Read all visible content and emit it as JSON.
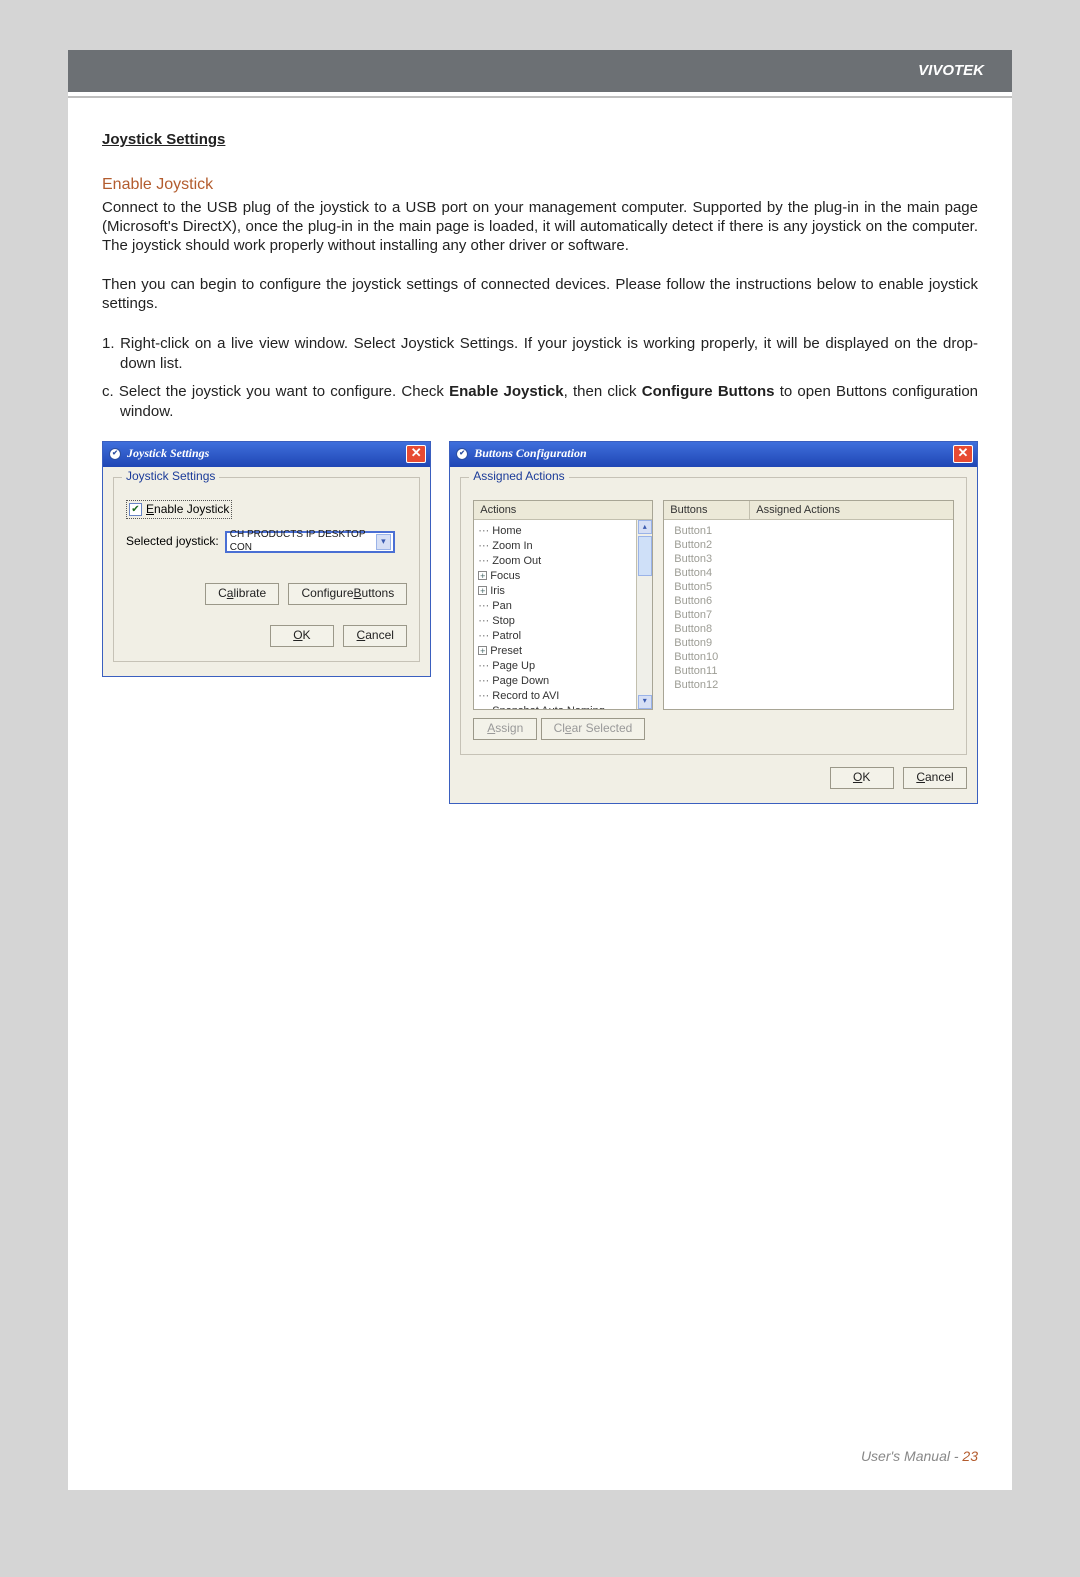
{
  "brand": "VIVOTEK",
  "section_title": "Joystick Settings",
  "subheading": "Enable Joystick",
  "para1": "Connect to the USB plug of the joystick to a USB port on your management computer. Supported by the plug-in in the main page (Microsoft's DirectX), once the plug-in in the main page is loaded, it will automatically detect if there is any joystick on the computer. The joystick should work properly without installing any other driver or software.",
  "para2": "Then you can begin to configure the joystick settings of connected devices. Please follow the instructions below to enable joystick settings.",
  "step1_prefix": "1. ",
  "step1": "Right-click on a live view window. Select Joystick Settings. If your joystick is working properly, it will be displayed on the drop-down list.",
  "stepc_prefix": "c. ",
  "stepc_a": "Select the joystick you want to configure. Check ",
  "stepc_bold1": "Enable Joystick",
  "stepc_mid": ", then click ",
  "stepc_bold2": "Configure Buttons",
  "stepc_b": " to open Buttons configuration window.",
  "dialog1": {
    "title": "Joystick Settings",
    "group_legend": "Joystick Settings",
    "enable_label": "Enable Joystick",
    "selected_label": "Selected joystick:",
    "selected_value": "CH PRODUCTS IP DESKTOP CON",
    "calibrate": "Calibrate",
    "configure": "Configure Buttons",
    "ok": "OK",
    "cancel": "Cancel"
  },
  "dialog2": {
    "title": "Buttons Configuration",
    "group_legend": "Assigned Actions",
    "actions_header": "Actions",
    "buttons_header": "Buttons",
    "assigned_header": "Assigned Actions",
    "actions": [
      "Home",
      "Zoom In",
      "Zoom Out",
      "Focus",
      "Iris",
      "Pan",
      "Stop",
      "Patrol",
      "Preset",
      "Page Up",
      "Page Down",
      "Record to AVI",
      "Snapshot Auto Naming"
    ],
    "actions_expandable": {
      "Focus": true,
      "Iris": true,
      "Preset": true
    },
    "buttons_list": [
      "Button1",
      "Button2",
      "Button3",
      "Button4",
      "Button5",
      "Button6",
      "Button7",
      "Button8",
      "Button9",
      "Button10",
      "Button11",
      "Button12"
    ],
    "assign": "Assign",
    "clear": "Clear Selected",
    "ok": "OK",
    "cancel": "Cancel"
  },
  "footer_label": "User's Manual - ",
  "footer_page": "23"
}
